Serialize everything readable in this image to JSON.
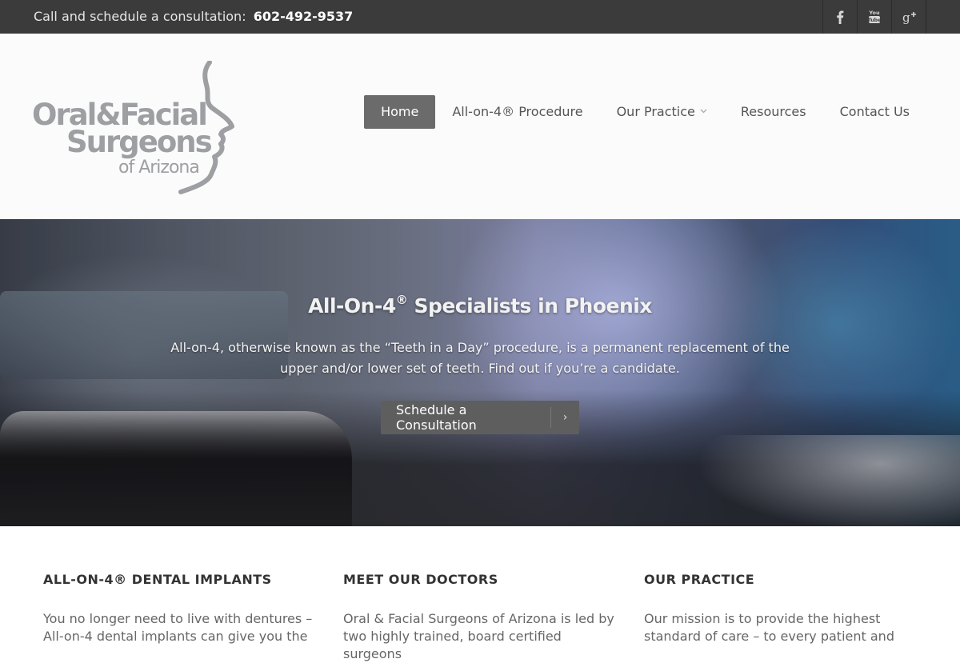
{
  "topbar": {
    "callout_text": "Call and schedule a consultation:",
    "phone": "602-492-9537",
    "social": [
      {
        "icon": "facebook-icon",
        "label": "f"
      },
      {
        "icon": "youtube-icon",
        "label": "You Tube"
      },
      {
        "icon": "google-plus-icon",
        "label": "g+"
      }
    ]
  },
  "logo": {
    "line1": "Oral&Facial",
    "line2": "Surgeons",
    "line3": "of Arizona",
    "color": "#9d9fa2"
  },
  "nav": {
    "items": [
      {
        "label": "Home",
        "active": true
      },
      {
        "label": "All-on-4® Procedure"
      },
      {
        "label": "Our Practice",
        "has_dropdown": true
      },
      {
        "label": "Resources"
      },
      {
        "label": "Contact Us"
      }
    ]
  },
  "hero": {
    "title_prefix": "All-On-4",
    "title_sup": "®",
    "title_suffix": " Specialists in Phoenix",
    "text": "All-on-4, otherwise known as the “Teeth in a Day” procedure, is a permanent replacement of the upper and/or lower set of teeth. Find out if you’re a candidate.",
    "button_label": "Schedule a Consultation",
    "button_arrow": "›"
  },
  "columns": [
    {
      "heading": "ALL-ON-4® DENTAL IMPLANTS",
      "text": "You no longer need to live with dentures – All-on-4 dental implants can give you the"
    },
    {
      "heading": "MEET OUR DOCTORS",
      "text": "Oral & Facial Surgeons of Arizona is led by two highly trained, board certified surgeons"
    },
    {
      "heading": "OUR PRACTICE",
      "text": "Our mission is to provide the highest standard of care – to every patient and"
    }
  ],
  "colors": {
    "topbar_bg": "#3b3b3b",
    "nav_active_bg": "#6b6b6b",
    "button_bg": "#5e5e5e"
  }
}
